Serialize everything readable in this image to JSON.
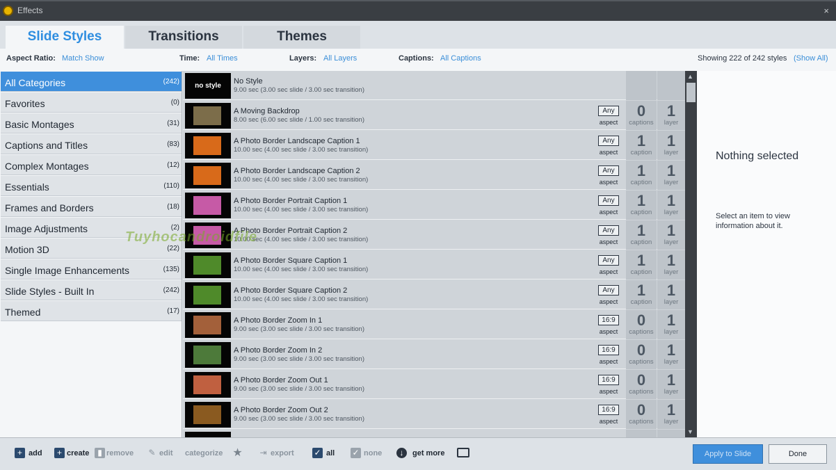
{
  "window": {
    "title": "Effects",
    "close_glyph": "×"
  },
  "tabs": [
    {
      "label": "Slide Styles",
      "active": true
    },
    {
      "label": "Transitions"
    },
    {
      "label": "Themes"
    }
  ],
  "filters": {
    "aspect_label": "Aspect Ratio:",
    "aspect_value": "Match Show",
    "time_label": "Time:",
    "time_value": "All Times",
    "layers_label": "Layers:",
    "layers_value": "All Layers",
    "captions_label": "Captions:",
    "captions_value": "All Captions",
    "showing": "Showing 222 of 242 styles",
    "show_all": "(Show All)"
  },
  "categories": [
    {
      "label": "All Categories",
      "count": "(242)"
    },
    {
      "label": "Favorites",
      "count": "(0)"
    },
    {
      "label": "Basic Montages",
      "count": "(31)"
    },
    {
      "label": "Captions and Titles",
      "count": "(83)"
    },
    {
      "label": "Complex Montages",
      "count": "(12)"
    },
    {
      "label": "Essentials",
      "count": "(110)"
    },
    {
      "label": "Frames and Borders",
      "count": "(18)"
    },
    {
      "label": "Image Adjustments",
      "count": "(2)"
    },
    {
      "label": "Motion 3D",
      "count": "(22)"
    },
    {
      "label": "Single Image Enhancements",
      "count": "(135)"
    },
    {
      "label": "Slide Styles - Built In",
      "count": "(242)"
    },
    {
      "label": "Themed",
      "count": "(17)"
    }
  ],
  "styles": [
    {
      "name": "No Style",
      "detail": "9.00 sec (3.00 sec slide / 3.00 sec transition)",
      "thumb_text": "no style",
      "thumb_color": "#050505"
    },
    {
      "name": "A Moving Backdrop",
      "detail": "8.00 sec (6.00 sec slide / 1.00 sec transition)",
      "aspect": "Any",
      "aspect_label": "aspect",
      "captions": "0",
      "captions_label": "captions",
      "layers": "1",
      "layers_label": "layer",
      "thumb_color": "#7c6d4a"
    },
    {
      "name": "A Photo Border Landscape Caption 1",
      "detail": "10.00 sec (4.00 sec slide / 3.00 sec transition)",
      "aspect": "Any",
      "aspect_label": "aspect",
      "captions": "1",
      "captions_label": "caption",
      "layers": "1",
      "layers_label": "layer",
      "thumb_color": "#d86a1a"
    },
    {
      "name": "A Photo Border Landscape Caption 2",
      "detail": "10.00 sec (4.00 sec slide / 3.00 sec transition)",
      "aspect": "Any",
      "aspect_label": "aspect",
      "captions": "1",
      "captions_label": "caption",
      "layers": "1",
      "layers_label": "layer",
      "thumb_color": "#d86a1a"
    },
    {
      "name": "A Photo Border Portrait Caption 1",
      "detail": "10.00 sec (4.00 sec slide / 3.00 sec transition)",
      "aspect": "Any",
      "aspect_label": "aspect",
      "captions": "1",
      "captions_label": "caption",
      "layers": "1",
      "layers_label": "layer",
      "thumb_color": "#c65aa6"
    },
    {
      "name": "A Photo Border Portrait Caption 2",
      "detail": "10.00 sec (4.00 sec slide / 3.00 sec transition)",
      "aspect": "Any",
      "aspect_label": "aspect",
      "captions": "1",
      "captions_label": "caption",
      "layers": "1",
      "layers_label": "layer",
      "thumb_color": "#c65aa6"
    },
    {
      "name": "A Photo Border Square Caption 1",
      "detail": "10.00 sec (4.00 sec slide / 3.00 sec transition)",
      "aspect": "Any",
      "aspect_label": "aspect",
      "captions": "1",
      "captions_label": "caption",
      "layers": "1",
      "layers_label": "layer",
      "thumb_color": "#4f8a2a"
    },
    {
      "name": "A Photo Border Square Caption 2",
      "detail": "10.00 sec (4.00 sec slide / 3.00 sec transition)",
      "aspect": "Any",
      "aspect_label": "aspect",
      "captions": "1",
      "captions_label": "caption",
      "layers": "1",
      "layers_label": "layer",
      "thumb_color": "#4f8a2a"
    },
    {
      "name": "A Photo Border Zoom In 1",
      "detail": "9.00 sec (3.00 sec slide / 3.00 sec transition)",
      "aspect": "16:9",
      "aspect_label": "aspect",
      "captions": "0",
      "captions_label": "captions",
      "layers": "1",
      "layers_label": "layer",
      "thumb_color": "#a3603a"
    },
    {
      "name": "A Photo Border Zoom In 2",
      "detail": "9.00 sec (3.00 sec slide / 3.00 sec transition)",
      "aspect": "16:9",
      "aspect_label": "aspect",
      "captions": "0",
      "captions_label": "captions",
      "layers": "1",
      "layers_label": "layer",
      "thumb_color": "#4d7a3a"
    },
    {
      "name": "A Photo Border Zoom Out 1",
      "detail": "9.00 sec (3.00 sec slide / 3.00 sec transition)",
      "aspect": "16:9",
      "aspect_label": "aspect",
      "captions": "0",
      "captions_label": "captions",
      "layers": "1",
      "layers_label": "layer",
      "thumb_color": "#c06040"
    },
    {
      "name": "A Photo Border Zoom Out 2",
      "detail": "9.00 sec (3.00 sec slide / 3.00 sec transition)",
      "aspect": "16:9",
      "aspect_label": "aspect",
      "captions": "0",
      "captions_label": "captions",
      "layers": "1",
      "layers_label": "layer",
      "thumb_color": "#8a5a20"
    }
  ],
  "info": {
    "heading": "Nothing selected",
    "text": "Select an item to view information about it."
  },
  "toolbar": {
    "add": "add",
    "create": "create",
    "remove": "remove",
    "edit": "edit",
    "categorize": "categorize",
    "export": "export",
    "all": "all",
    "none": "none",
    "get_more": "get more"
  },
  "buttons": {
    "apply": "Apply to Slide",
    "done": "Done"
  },
  "watermark": "Tuyhocandroidfile",
  "colors": {
    "accent": "#3f8fdc",
    "titlebar": "#3a3e43"
  }
}
